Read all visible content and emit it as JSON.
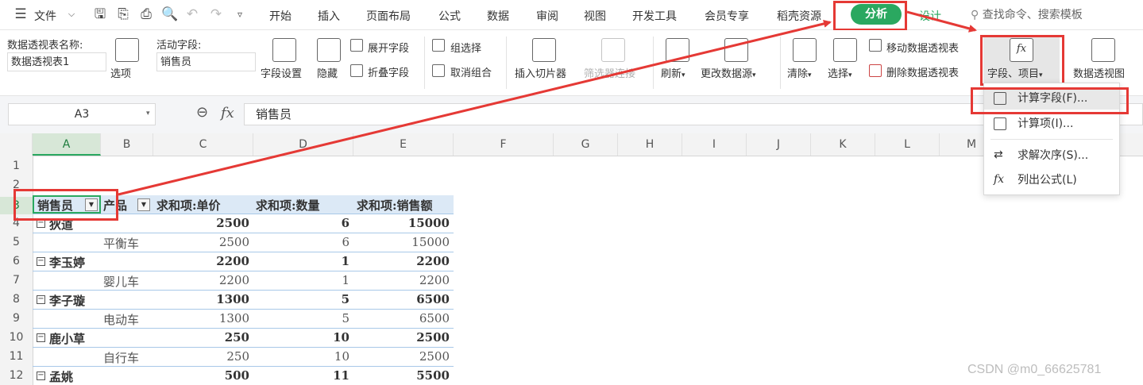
{
  "menu": {
    "file_label": "文件",
    "tabs": [
      "开始",
      "插入",
      "页面布局",
      "公式",
      "数据",
      "审阅",
      "视图",
      "开发工具",
      "会员专享",
      "稻壳资源"
    ],
    "active_tab": "分析",
    "design_tab": "设计",
    "search_placeholder": "查找命令、搜索模板"
  },
  "ribbon": {
    "pivot_name_label": "数据透视表名称:",
    "pivot_name_value": "数据透视表1",
    "options_label": "选项",
    "active_field_label": "活动字段:",
    "active_field_value": "销售员",
    "field_settings": "字段设置",
    "hide": "隐藏",
    "expand_field": "展开字段",
    "collapse_field": "折叠字段",
    "group_selection": "组选择",
    "ungroup": "取消组合",
    "insert_slicer": "插入切片器",
    "filter_connection": "筛选器连接",
    "refresh": "刷新",
    "change_source": "更改数据源",
    "clear": "清除",
    "select": "选择",
    "move_pivot": "移动数据透视表",
    "delete_pivot": "删除数据透视表",
    "fields_items": "字段、项目",
    "pivot_chart": "数据透视图"
  },
  "formula_bar": {
    "cell_ref": "A3",
    "fx": "fx",
    "value": "销售员"
  },
  "columns": [
    "A",
    "B",
    "C",
    "D",
    "E",
    "F",
    "G",
    "H",
    "I",
    "J",
    "K",
    "L",
    "M"
  ],
  "rows": [
    "1",
    "2",
    "3",
    "4",
    "5",
    "6",
    "7",
    "8",
    "9",
    "10",
    "11",
    "12"
  ],
  "pivot": {
    "headers": [
      "销售员",
      "产品",
      "求和项:单价",
      "求和项:数量",
      "求和项:销售额"
    ],
    "groups": [
      {
        "name": "狄道",
        "price": "2500",
        "qty": "6",
        "sales": "15000",
        "product": "平衡车",
        "p_price": "2500",
        "p_qty": "6",
        "p_sales": "15000"
      },
      {
        "name": "李玉婷",
        "price": "2200",
        "qty": "1",
        "sales": "2200",
        "product": "婴儿车",
        "p_price": "2200",
        "p_qty": "1",
        "p_sales": "2200"
      },
      {
        "name": "李子璇",
        "price": "1300",
        "qty": "5",
        "sales": "6500",
        "product": "电动车",
        "p_price": "1300",
        "p_qty": "5",
        "p_sales": "6500"
      },
      {
        "name": "鹿小草",
        "price": "250",
        "qty": "10",
        "sales": "2500",
        "product": "自行车",
        "p_price": "250",
        "p_qty": "10",
        "p_sales": "2500"
      },
      {
        "name": "孟姚",
        "price": "500",
        "qty": "11",
        "sales": "5500"
      }
    ]
  },
  "dropdown": {
    "items": [
      "计算字段(F)...",
      "计算项(I)...",
      "求解次序(S)...",
      "列出公式(L)"
    ]
  },
  "watermark": "CSDN @m0_66625781",
  "colors": {
    "accent_green": "#2aa860",
    "annotation_red": "#e53935",
    "pivot_header_bg": "#dce9f6"
  }
}
